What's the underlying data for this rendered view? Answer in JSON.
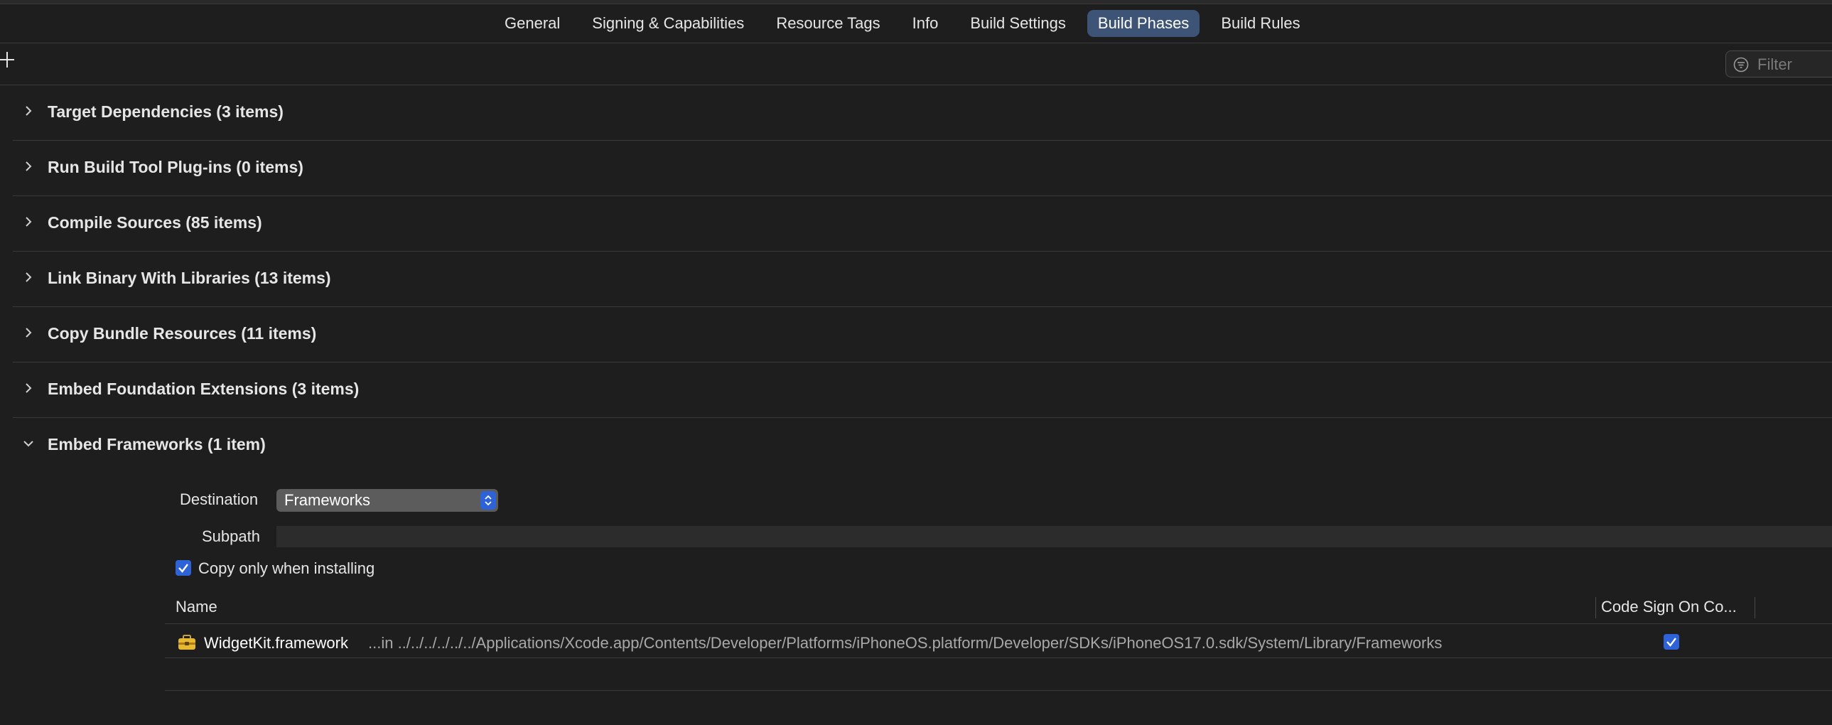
{
  "tabs": [
    {
      "label": "General",
      "active": false
    },
    {
      "label": "Signing & Capabilities",
      "active": false
    },
    {
      "label": "Resource Tags",
      "active": false
    },
    {
      "label": "Info",
      "active": false
    },
    {
      "label": "Build Settings",
      "active": false
    },
    {
      "label": "Build Phases",
      "active": true
    },
    {
      "label": "Build Rules",
      "active": false
    }
  ],
  "toolbar": {
    "add_icon": "plus-icon",
    "filter_placeholder": "Filter",
    "filter_icon": "filter-icon"
  },
  "phases": [
    {
      "label": "Target Dependencies (3 items)",
      "expanded": false
    },
    {
      "label": "Run Build Tool Plug-ins (0 items)",
      "expanded": false
    },
    {
      "label": "Compile Sources (85 items)",
      "expanded": false
    },
    {
      "label": "Link Binary With Libraries (13 items)",
      "expanded": false
    },
    {
      "label": "Copy Bundle Resources (11 items)",
      "expanded": false
    },
    {
      "label": "Embed Foundation Extensions (3 items)",
      "expanded": false
    },
    {
      "label": "Embed Frameworks (1 item)",
      "expanded": true
    }
  ],
  "embed": {
    "destination_label": "Destination",
    "destination_value": "Frameworks",
    "subpath_label": "Subpath",
    "subpath_value": "",
    "copy_only_label": "Copy only when installing",
    "copy_only_checked": true,
    "columns": {
      "name": "Name",
      "code_sign": "Code Sign On Co..."
    },
    "rows": [
      {
        "icon": "framework-toolbox-icon",
        "name": "WidgetKit.framework",
        "path": "...in ../../../../../../Applications/Xcode.app/Contents/Developer/Platforms/iPhoneOS.platform/Developer/SDKs/iPhoneOS17.0.sdk/System/Library/Frameworks",
        "code_sign": true
      }
    ]
  },
  "colors": {
    "background": "#1e1e1e",
    "active_tab": "#3d5476",
    "accent": "#2e63d8"
  }
}
